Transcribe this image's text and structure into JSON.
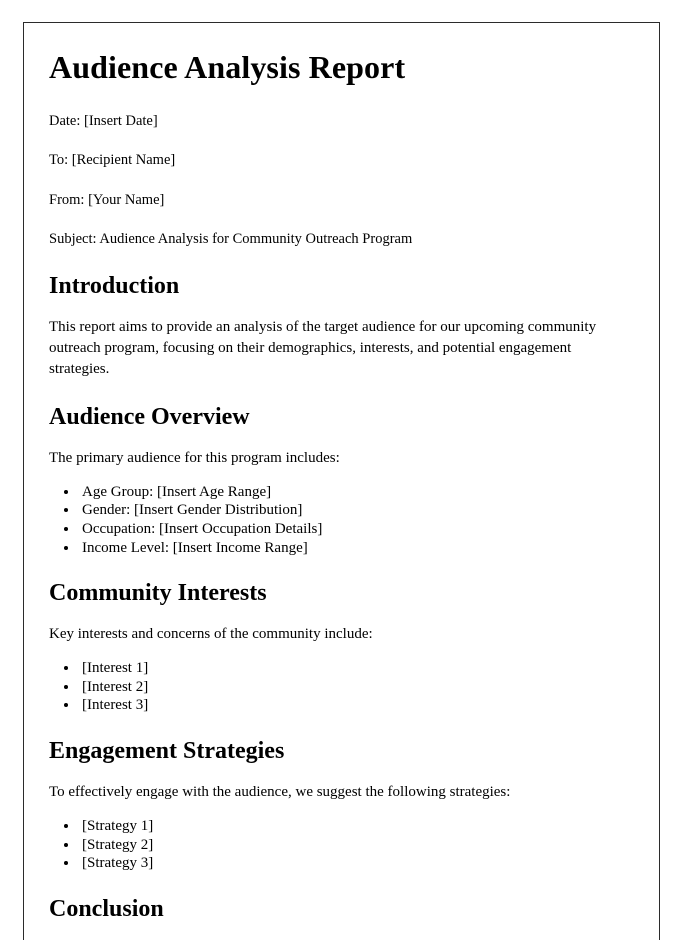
{
  "document": {
    "title": "Audience Analysis Report",
    "meta": [
      {
        "label": "Date",
        "text": "Date: [Insert Date]"
      },
      {
        "label": "To",
        "text": "To: [Recipient Name]"
      },
      {
        "label": "From",
        "text": "From: [Your Name]"
      },
      {
        "label": "Subject",
        "text": "Subject: Audience Analysis for Community Outreach Program"
      }
    ],
    "sections": [
      {
        "heading": "Introduction",
        "paragraph": "This report aims to provide an analysis of the target audience for our upcoming community outreach program, focusing on their demographics, interests, and potential engagement strategies.",
        "items": []
      },
      {
        "heading": "Audience Overview",
        "paragraph": "The primary audience for this program includes:",
        "items": [
          "Age Group: [Insert Age Range]",
          "Gender: [Insert Gender Distribution]",
          "Occupation: [Insert Occupation Details]",
          "Income Level: [Insert Income Range]"
        ]
      },
      {
        "heading": "Community Interests",
        "paragraph": "Key interests and concerns of the community include:",
        "items": [
          "[Interest 1]",
          "[Interest 2]",
          "[Interest 3]"
        ]
      },
      {
        "heading": "Engagement Strategies",
        "paragraph": "To effectively engage with the audience, we suggest the following strategies:",
        "items": [
          "[Strategy 1]",
          "[Strategy 2]",
          "[Strategy 3]"
        ]
      },
      {
        "heading": "Conclusion",
        "paragraph": "",
        "items": []
      }
    ]
  },
  "colors": {
    "page_background": "#ffffff",
    "text": "#000000",
    "border": "#2b2b2b"
  }
}
